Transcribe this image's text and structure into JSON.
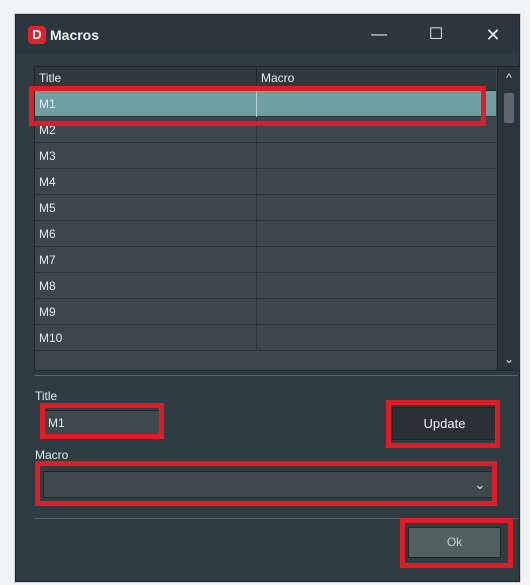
{
  "window": {
    "logo_letter": "D",
    "title": "Macros",
    "minimize_glyph": "—",
    "maximize_glyph": "☐",
    "close_glyph": "✕"
  },
  "table": {
    "columns": [
      "Title",
      "Macro"
    ],
    "rows": [
      {
        "title": "M1",
        "macro": "",
        "selected": true
      },
      {
        "title": "M2",
        "macro": "",
        "selected": false
      },
      {
        "title": "M3",
        "macro": "",
        "selected": false
      },
      {
        "title": "M4",
        "macro": "",
        "selected": false
      },
      {
        "title": "M5",
        "macro": "",
        "selected": false
      },
      {
        "title": "M6",
        "macro": "",
        "selected": false
      },
      {
        "title": "M7",
        "macro": "",
        "selected": false
      },
      {
        "title": "M8",
        "macro": "",
        "selected": false
      },
      {
        "title": "M9",
        "macro": "",
        "selected": false
      },
      {
        "title": "M10",
        "macro": "",
        "selected": false
      }
    ],
    "scroll_up_glyph": "^",
    "scroll_down_glyph": "⌄"
  },
  "form": {
    "title_label": "Title",
    "title_value": "M1",
    "update_label": "Update",
    "macro_label": "Macro",
    "macro_value": "",
    "macro_arrow_glyph": "⌄",
    "ok_label": "Ok"
  },
  "colors": {
    "window_bg": "#2f3c42",
    "selected_row": "#6f9fa0",
    "highlight_box": "#e01c26",
    "ok_button": "#52615d"
  },
  "icons": {
    "app": "app-logo-icon",
    "minimize": "minimize-icon",
    "maximize": "maximize-icon",
    "close": "close-icon",
    "scroll_up": "chevron-up-icon",
    "scroll_down": "chevron-down-icon",
    "dropdown": "chevron-down-icon"
  }
}
